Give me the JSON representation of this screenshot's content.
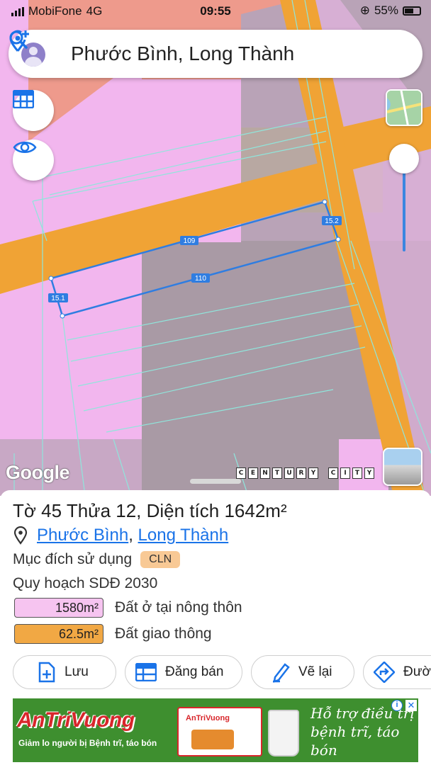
{
  "status_bar": {
    "carrier": "MobiFone",
    "network": "4G",
    "time": "09:55",
    "battery": "55%"
  },
  "search": {
    "query": "Phước Bình, Long Thành"
  },
  "map": {
    "edge_labels": [
      "109",
      "110",
      "15.1",
      "15.2"
    ],
    "attribution": "Google",
    "watermark": [
      "C",
      "E",
      "N",
      "T",
      "U",
      "R",
      "Y",
      "",
      "C",
      "I",
      "T",
      "Y"
    ],
    "colors": {
      "residential": "#f2b6ee",
      "road": "#f0a335",
      "commercial": "#ee9a8c",
      "parcel_outline": "#2f7de1"
    }
  },
  "parcel": {
    "title": "Tờ 45 Thửa 12, Diện tích 1642m²",
    "ward": "Phước Bình",
    "separator": ", ",
    "district": "Long Thành",
    "purpose_label": "Mục đích sử dụng",
    "purpose_code": "CLN",
    "planning_label": "Quy hoạch SDĐ 2030",
    "land_uses": [
      {
        "area": "1580m²",
        "label": "Đất ở tại nông thôn",
        "color": "#f6c4f0"
      },
      {
        "area": "62.5m²",
        "label": "Đất giao thông",
        "color": "#f1a844"
      }
    ]
  },
  "actions": [
    "Lưu",
    "Đăng bán",
    "Vẽ lại",
    "Đường đi"
  ],
  "ad": {
    "brand": "AnTriVuong",
    "subtext": "Giảm lo người bị Bệnh trĩ, táo bón",
    "box_label": "AnTriVuong",
    "slogan": "Hỗ trợ điều trị bệnh trĩ, táo bón",
    "info": "i",
    "close": "✕"
  }
}
